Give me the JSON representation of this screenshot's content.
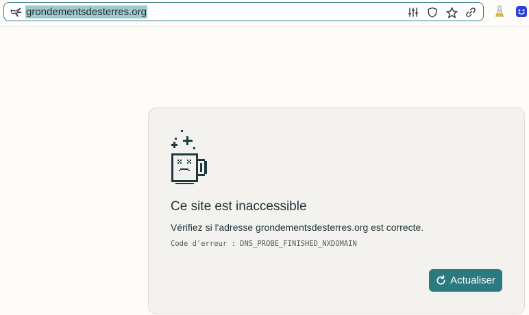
{
  "browser": {
    "url": "grondementsdesterres.org",
    "site_icon": "broken-bird-icon",
    "actions": [
      "page-settings-icon",
      "shield-icon",
      "star-icon",
      "link-icon"
    ],
    "extensions": [
      "flask-icon",
      "smiley-face-icon"
    ]
  },
  "error_page": {
    "illustration": "sad-mug-icon",
    "title": "Ce site est inaccessible",
    "message": "Vérifiez si l'adresse grondementsdesterres.org est correcte.",
    "code": "Code d'erreur : DNS_PROBE_FINISHED_NXDOMAIN",
    "reload_label": "Actualiser",
    "reload_icon": "refresh-icon"
  },
  "colors": {
    "accent": "#2a7a80",
    "url_highlight": "#a3c9cb",
    "text": "#1e3336"
  }
}
